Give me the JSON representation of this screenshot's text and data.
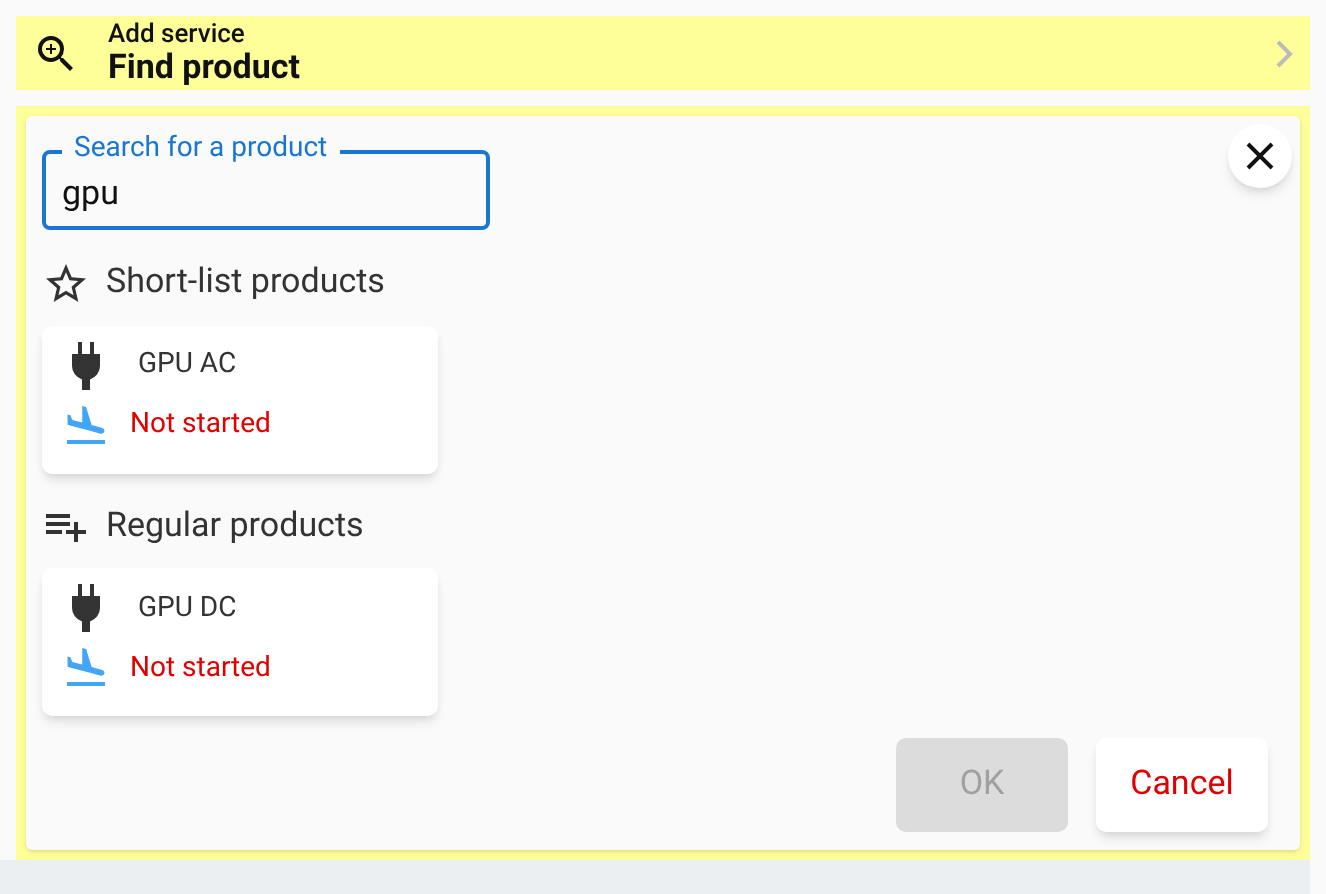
{
  "header": {
    "subtitle": "Add service",
    "title": "Find product"
  },
  "search": {
    "label": "Search for a product",
    "value": "gpu"
  },
  "sections": [
    {
      "kind": "shortlist",
      "title": "Short-list products",
      "products": [
        {
          "name": "GPU AC",
          "status": "Not started"
        }
      ]
    },
    {
      "kind": "regular",
      "title": "Regular products",
      "products": [
        {
          "name": "GPU DC",
          "status": "Not started"
        }
      ]
    }
  ],
  "buttons": [
    {
      "kind": "ok",
      "label": "OK",
      "disabled": true
    },
    {
      "kind": "cancel",
      "label": "Cancel",
      "disabled": false
    }
  ]
}
